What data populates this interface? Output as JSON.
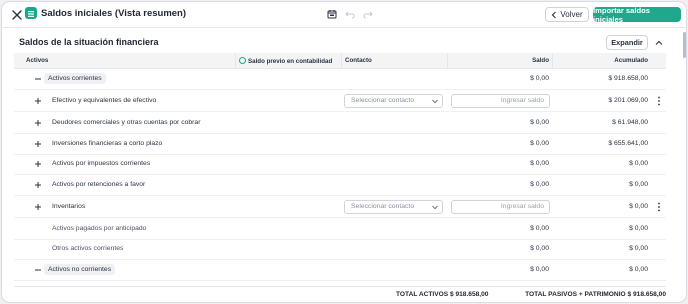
{
  "header": {
    "title": "Saldos iniciales (Vista resumen)",
    "back_label": "Volver",
    "import_label": "Importar saldos iniciales"
  },
  "section": {
    "title": "Saldos de la situación financiera",
    "expand_label": "Expandir"
  },
  "table": {
    "columns": {
      "activos": "Activos",
      "saldo_previo": "Saldo previo en contabilidad",
      "contacto": "Contacto",
      "saldo": "Saldo",
      "acumulado": "Acumulado"
    },
    "contact_placeholder": "Seleccionar contacto",
    "saldo_placeholder": "Ingresar saldo",
    "rows": [
      {
        "label": "Activos corrientes",
        "type": "group",
        "saldo": "$ 0,00",
        "acumulado": "$ 918.658,00"
      },
      {
        "label": "Efectivo y equivalentes de efectivo",
        "type": "expandable-edit",
        "saldo": "",
        "acumulado": "$ 201.069,00"
      },
      {
        "label": "Deudores comerciales y otras cuentas por cobrar",
        "type": "expandable",
        "saldo": "$ 0,00",
        "acumulado": "$ 61.948,00"
      },
      {
        "label": "Inversiones financieras a corto plazo",
        "type": "expandable",
        "saldo": "$ 0,00",
        "acumulado": "$ 655.641,00"
      },
      {
        "label": "Activos por impuestos corrientes",
        "type": "expandable",
        "saldo": "$ 0,00",
        "acumulado": "$ 0,00"
      },
      {
        "label": "Activos por retenciones a favor",
        "type": "expandable",
        "saldo": "$ 0,00",
        "acumulado": "$ 0,00"
      },
      {
        "label": "Inventarios",
        "type": "expandable-edit",
        "saldo": "",
        "acumulado": "$ 0,00"
      },
      {
        "label": "Activos pagados por anticipado",
        "type": "leaf",
        "saldo": "$ 0,00",
        "acumulado": "$ 0,00"
      },
      {
        "label": "Otros activos corrientes",
        "type": "leaf",
        "saldo": "$ 0,00",
        "acumulado": "$ 0,00"
      },
      {
        "label": "Activos no corrientes",
        "type": "group",
        "saldo": "$ 0,00",
        "acumulado": "$ 0,00"
      }
    ]
  },
  "footer": {
    "total_activos": "TOTAL ACTIVOS $ 918.658,00",
    "total_pasivos": "TOTAL PASIVOS + PATRIMONIO $ 918.658,00"
  },
  "colors": {
    "accent": "#1fa88c",
    "text": "#2a3140"
  }
}
